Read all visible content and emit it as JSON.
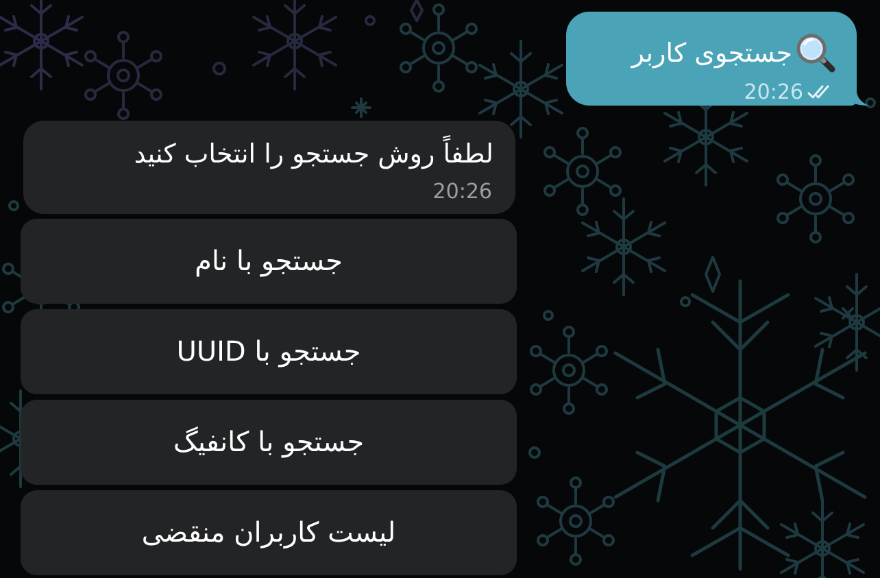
{
  "outgoing_message": {
    "text": "جستجوی کاربر",
    "time": "20:26",
    "emoji": "magnifying-glass-icon",
    "status": "double-check-icon",
    "bubble_color": "#4aa3b7"
  },
  "incoming_message": {
    "text": "لطفاً روش جستجو را انتخاب کنید",
    "time": "20:26",
    "bubble_color": "#222425"
  },
  "keyboard": {
    "buttons": [
      {
        "label": "جستجو با نام"
      },
      {
        "label": "جستجو با UUID"
      },
      {
        "label": "جستجو با کانفیگ"
      },
      {
        "label": "لیست کاربران منقضی"
      }
    ]
  },
  "colors": {
    "background": "#050708",
    "pattern": "#1e3a40"
  }
}
